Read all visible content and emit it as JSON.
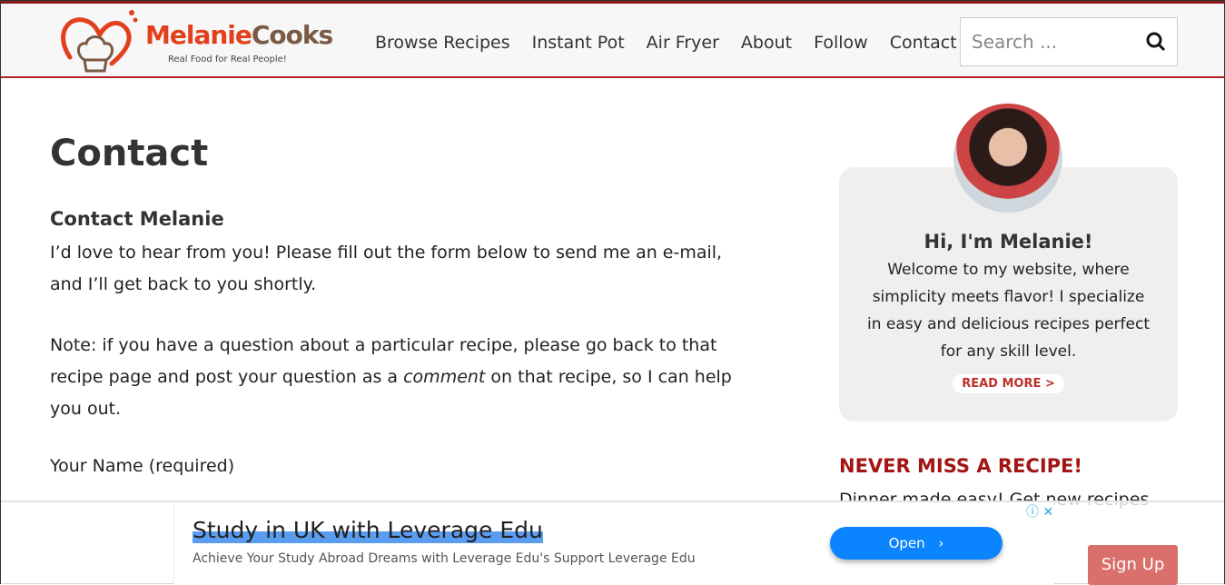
{
  "header": {
    "brand_first": "Melanie",
    "brand_second": "Cooks",
    "tagline": "Real Food for Real People!",
    "nav": [
      "Browse Recipes",
      "Instant Pot",
      "Air Fryer",
      "About",
      "Follow",
      "Contact"
    ],
    "search_placeholder": "Search ..."
  },
  "main": {
    "title": "Contact",
    "subtitle": "Contact Melanie",
    "para1": "I’d love to hear from you! Please fill out the form below to send me an e-mail, and I’ll get back to you shortly.",
    "para2_a": "Note: if you have a question about a particular recipe, please go back to that recipe page and post your question as a ",
    "para2_em": "comment",
    "para2_b": " on that recipe, so I can help you out.",
    "name_label": "Your Name (required)"
  },
  "sidebar": {
    "greeting": "Hi, I'm Melanie!",
    "bio": "Welcome to my website, where simplicity meets flavor! I specialize in easy and delicious recipes perfect for any skill level.",
    "read_more": "READ MORE >",
    "newsletter_title": "NEVER MISS A RECIPE!",
    "newsletter_text": "Dinner made easy! Get new recipes delivered to your inbox:",
    "signup": "Sign Up"
  },
  "ad": {
    "title": "Study in UK with Leverage Edu",
    "subtitle": "Achieve Your Study Abroad Dreams with Leverage Edu's Support Leverage Edu",
    "open": "Open"
  },
  "colors": {
    "brand_red": "#e2401c",
    "accent": "#a31515",
    "ad_button": "#0a84ff"
  }
}
